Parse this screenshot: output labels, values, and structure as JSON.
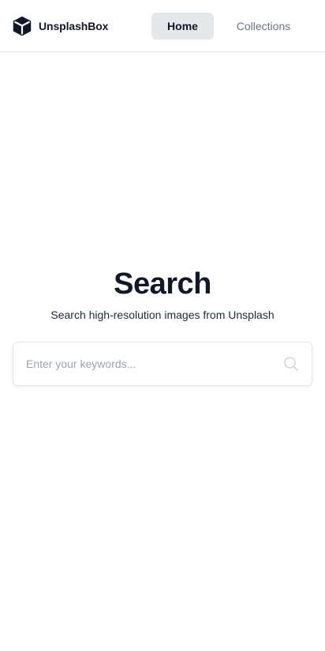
{
  "header": {
    "brand_name": "UnsplashBox",
    "brand_icon": "cube-icon",
    "nav": [
      {
        "label": "Home",
        "active": true
      },
      {
        "label": "Collections",
        "active": false
      }
    ]
  },
  "main": {
    "title": "Search",
    "subtitle": "Search high-resolution images from Unsplash",
    "search": {
      "placeholder": "Enter your keywords...",
      "value": "",
      "icon": "search-icon"
    }
  },
  "colors": {
    "active_nav_bg": "#e5e7eb",
    "text_primary": "#111827",
    "text_muted": "#6b7280",
    "placeholder": "#9ca3af"
  }
}
